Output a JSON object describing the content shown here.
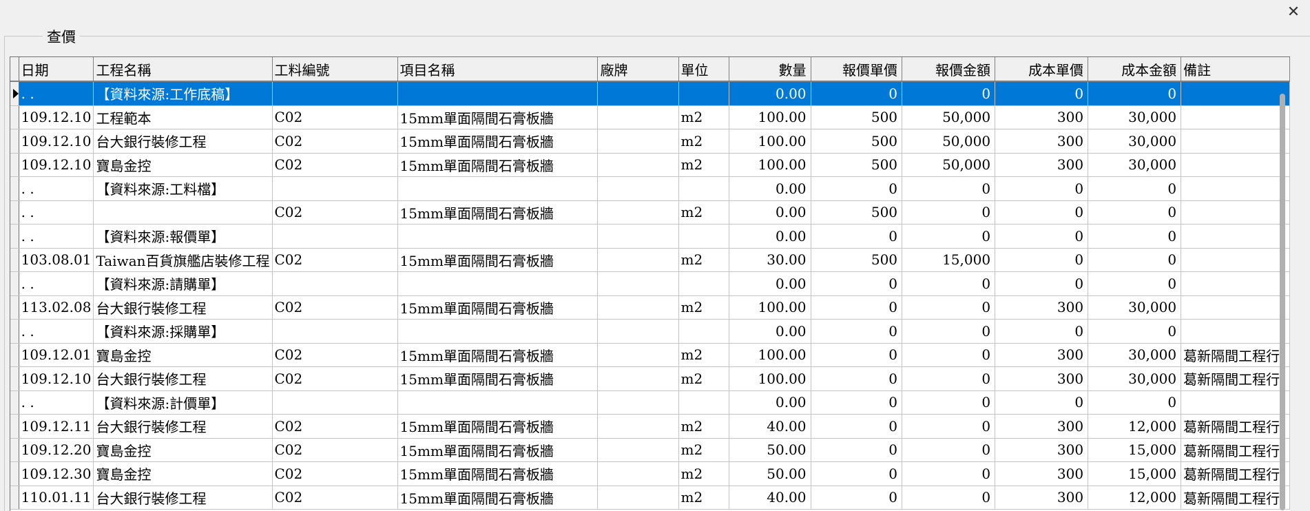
{
  "window": {
    "title": "查價",
    "close_glyph": "✕"
  },
  "table": {
    "columns": [
      {
        "key": "date",
        "label": "日期",
        "w": 96
      },
      {
        "key": "project",
        "label": "工程名稱",
        "w": 240
      },
      {
        "key": "code",
        "label": "工料編號",
        "w": 194
      },
      {
        "key": "item",
        "label": "項目名稱",
        "w": 296
      },
      {
        "key": "brand",
        "label": "廠牌",
        "w": 124
      },
      {
        "key": "unit",
        "label": "單位",
        "w": 72
      },
      {
        "key": "qty",
        "label": "數量",
        "w": 116,
        "num": true
      },
      {
        "key": "qprice",
        "label": "報價單價",
        "w": 131,
        "num": true
      },
      {
        "key": "qamt",
        "label": "報價金額",
        "w": 134,
        "num": true
      },
      {
        "key": "cprice",
        "label": "成本單價",
        "w": 134,
        "num": true
      },
      {
        "key": "camt",
        "label": "成本金額",
        "w": 134,
        "num": true
      },
      {
        "key": "note",
        "label": "備註",
        "w": 153
      }
    ],
    "rows": [
      {
        "date": "  . .",
        "project": "【資料來源:工作底稿】",
        "code": "",
        "item": "",
        "brand": "",
        "unit": "",
        "qty": "0.00",
        "qprice": "0",
        "qamt": "0",
        "cprice": "0",
        "camt": "0",
        "note": ""
      },
      {
        "date": "109.12.10",
        "project": "工程範本",
        "code": "C02",
        "item": "15mm單面隔間石膏板牆",
        "brand": "",
        "unit": "m2",
        "qty": "100.00",
        "qprice": "500",
        "qamt": "50,000",
        "cprice": "300",
        "camt": "30,000",
        "note": ""
      },
      {
        "date": "109.12.10",
        "project": "台大銀行裝修工程",
        "code": "C02",
        "item": "15mm單面隔間石膏板牆",
        "brand": "",
        "unit": "m2",
        "qty": "100.00",
        "qprice": "500",
        "qamt": "50,000",
        "cprice": "300",
        "camt": "30,000",
        "note": ""
      },
      {
        "date": "109.12.10",
        "project": "寶島金控",
        "code": "C02",
        "item": "15mm單面隔間石膏板牆",
        "brand": "",
        "unit": "m2",
        "qty": "100.00",
        "qprice": "500",
        "qamt": "50,000",
        "cprice": "300",
        "camt": "30,000",
        "note": ""
      },
      {
        "date": "  . .",
        "project": "【資料來源:工料檔】",
        "code": "",
        "item": "",
        "brand": "",
        "unit": "",
        "qty": "0.00",
        "qprice": "0",
        "qamt": "0",
        "cprice": "0",
        "camt": "0",
        "note": ""
      },
      {
        "date": "  . .",
        "project": "",
        "code": "C02",
        "item": "15mm單面隔間石膏板牆",
        "brand": "",
        "unit": "m2",
        "qty": "0.00",
        "qprice": "500",
        "qamt": "0",
        "cprice": "0",
        "camt": "0",
        "note": ""
      },
      {
        "date": "  . .",
        "project": "【資料來源:報價單】",
        "code": "",
        "item": "",
        "brand": "",
        "unit": "",
        "qty": "0.00",
        "qprice": "0",
        "qamt": "0",
        "cprice": "0",
        "camt": "0",
        "note": ""
      },
      {
        "date": "103.08.01",
        "project": "Taiwan百貨旗艦店裝修工程",
        "code": "C02",
        "item": "15mm單面隔間石膏板牆",
        "brand": "",
        "unit": "m2",
        "qty": "30.00",
        "qprice": "500",
        "qamt": "15,000",
        "cprice": "0",
        "camt": "0",
        "note": ""
      },
      {
        "date": "  . .",
        "project": "【資料來源:請購單】",
        "code": "",
        "item": "",
        "brand": "",
        "unit": "",
        "qty": "0.00",
        "qprice": "0",
        "qamt": "0",
        "cprice": "0",
        "camt": "0",
        "note": ""
      },
      {
        "date": "113.02.08",
        "project": "台大銀行裝修工程",
        "code": "C02",
        "item": "15mm單面隔間石膏板牆",
        "brand": "",
        "unit": "m2",
        "qty": "100.00",
        "qprice": "0",
        "qamt": "0",
        "cprice": "300",
        "camt": "30,000",
        "note": ""
      },
      {
        "date": "  . .",
        "project": "【資料來源:採購單】",
        "code": "",
        "item": "",
        "brand": "",
        "unit": "",
        "qty": "0.00",
        "qprice": "0",
        "qamt": "0",
        "cprice": "0",
        "camt": "0",
        "note": ""
      },
      {
        "date": "109.12.01",
        "project": "寶島金控",
        "code": "C02",
        "item": "15mm單面隔間石膏板牆",
        "brand": "",
        "unit": "m2",
        "qty": "100.00",
        "qprice": "0",
        "qamt": "0",
        "cprice": "300",
        "camt": "30,000",
        "note": "葛新隔間工程行"
      },
      {
        "date": "109.12.10",
        "project": "台大銀行裝修工程",
        "code": "C02",
        "item": "15mm單面隔間石膏板牆",
        "brand": "",
        "unit": "m2",
        "qty": "100.00",
        "qprice": "0",
        "qamt": "0",
        "cprice": "300",
        "camt": "30,000",
        "note": "葛新隔間工程行"
      },
      {
        "date": "  . .",
        "project": "【資料來源:計價單】",
        "code": "",
        "item": "",
        "brand": "",
        "unit": "",
        "qty": "0.00",
        "qprice": "0",
        "qamt": "0",
        "cprice": "0",
        "camt": "0",
        "note": ""
      },
      {
        "date": "109.12.11",
        "project": "台大銀行裝修工程",
        "code": "C02",
        "item": "15mm單面隔間石膏板牆",
        "brand": "",
        "unit": "m2",
        "qty": "40.00",
        "qprice": "0",
        "qamt": "0",
        "cprice": "300",
        "camt": "12,000",
        "note": "葛新隔間工程行"
      },
      {
        "date": "109.12.20",
        "project": "寶島金控",
        "code": "C02",
        "item": "15mm單面隔間石膏板牆",
        "brand": "",
        "unit": "m2",
        "qty": "50.00",
        "qprice": "0",
        "qamt": "0",
        "cprice": "300",
        "camt": "15,000",
        "note": "葛新隔間工程行"
      },
      {
        "date": "109.12.30",
        "project": "寶島金控",
        "code": "C02",
        "item": "15mm單面隔間石膏板牆",
        "brand": "",
        "unit": "m2",
        "qty": "50.00",
        "qprice": "0",
        "qamt": "0",
        "cprice": "300",
        "camt": "15,000",
        "note": "葛新隔間工程行"
      },
      {
        "date": "110.01.11",
        "project": "台大銀行裝修工程",
        "code": "C02",
        "item": "15mm單面隔間石膏板牆",
        "brand": "",
        "unit": "m2",
        "qty": "40.00",
        "qprice": "0",
        "qamt": "0",
        "cprice": "300",
        "camt": "12,000",
        "note": "葛新隔間工程行"
      }
    ],
    "selected_row": 0,
    "selection_color": "#0078d7"
  }
}
